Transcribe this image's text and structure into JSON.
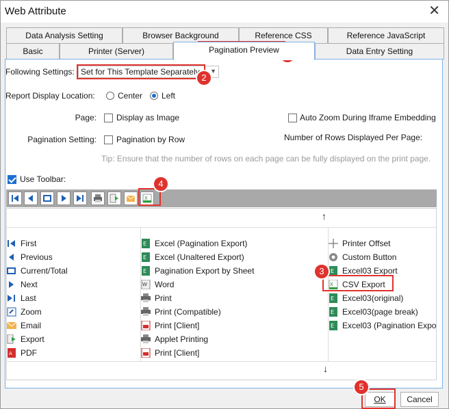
{
  "window": {
    "title": "Web Attribute"
  },
  "tabs_row1": [
    "Data Analysis Setting",
    "Browser Background",
    "Reference CSS",
    "Reference JavaScript"
  ],
  "tabs_row2": [
    "Basic",
    "Printer (Server)",
    "Pagination Preview",
    "Data Entry Setting"
  ],
  "settings": {
    "following_label": "Following Settings:",
    "following_value": "Set for This Template Separately",
    "location_label": "Report Display Location:",
    "center_label": "Center",
    "left_label": "Left",
    "page_label": "Page:",
    "display_image_label": "Display as Image",
    "auto_zoom_label": "Auto Zoom During Iframe Embedding",
    "pagination_label": "Pagination Setting:",
    "by_row_label": "Pagination by Row",
    "rows_per_page_label": "Number of Rows Displayed Per Page:",
    "tip": "Tip: Ensure that the number of rows on each page can be fully displayed on the print page.",
    "use_toolbar_label": "Use Toolbar:"
  },
  "column1": [
    "First",
    "Previous",
    "Current/Total",
    "Next",
    "Last",
    "Zoom",
    "Email",
    "Export",
    "PDF"
  ],
  "column2": [
    "Excel (Pagination Export)",
    "Excel (Unaltered Export)",
    "Pagination Export by Sheet",
    "Word",
    "Print",
    "Print (Compatible)",
    "Print [Client]",
    "Applet Printing",
    "Print [Client]"
  ],
  "column3": [
    "Printer Offset",
    "Custom Button",
    "Excel03 Export",
    "CSV Export",
    "Excel03(original)",
    "Excel03(page break)",
    "Excel03 (Pagination Expo"
  ],
  "buttons": {
    "ok": "OK",
    "cancel": "Cancel"
  },
  "callouts": [
    "1",
    "2",
    "3",
    "4",
    "5"
  ],
  "colors": {
    "accent": "#1f6fd1",
    "callout": "#e0322d",
    "toolbar": "#a9a9a9"
  }
}
